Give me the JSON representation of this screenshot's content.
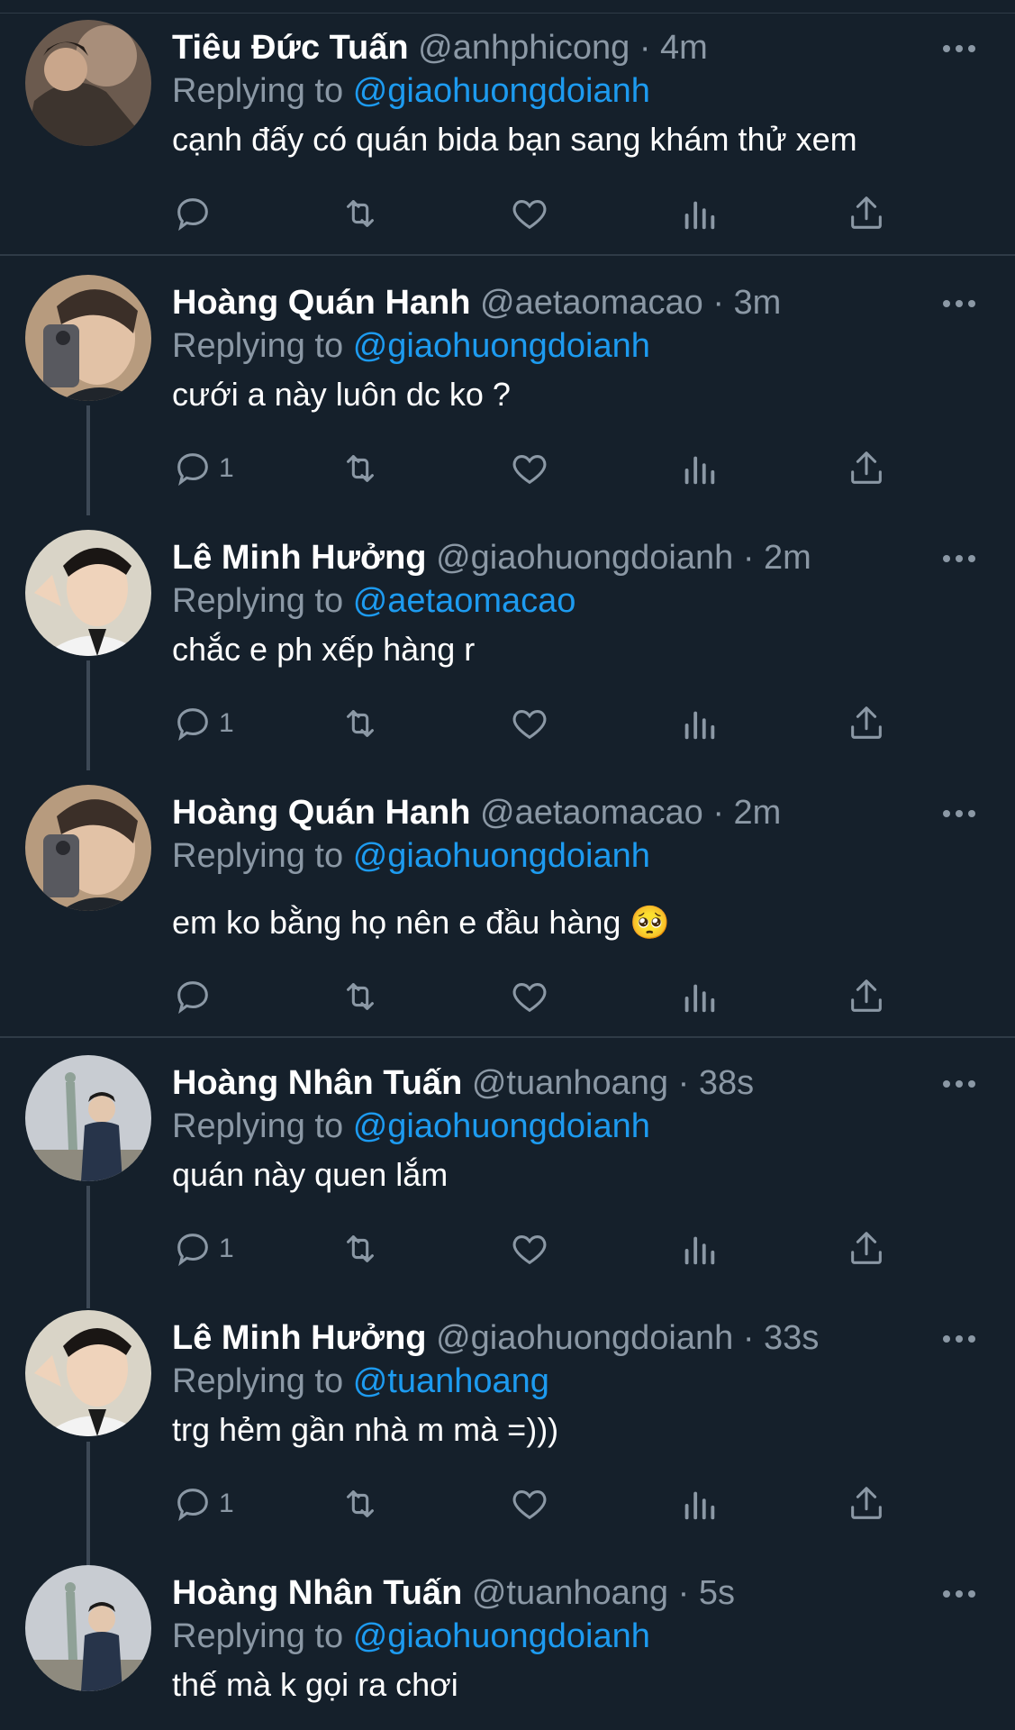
{
  "colors": {
    "background": "#15202b",
    "mention": "#1d9bf0",
    "muted": "#8b98a5",
    "divider": "#2f3b47"
  },
  "icons": {
    "reply": "reply-icon",
    "retweet": "retweet-icon",
    "like": "heart-icon",
    "analytics": "analytics-icon",
    "share": "share-icon",
    "more": "more-icon"
  },
  "tweets": [
    {
      "name": "Tiêu Đức Tuấn",
      "handle": "@anhphicong",
      "dot": "·",
      "time": "4m",
      "replying_label": "Replying to",
      "replying_to": "@giaohuongdoianh",
      "text": "cạnh đấy có quán bida bạn sang khám thử xem",
      "reply_count": ""
    },
    {
      "name": "Hoàng Quán Hanh",
      "handle": "@aetaomacao",
      "dot": "·",
      "time": "3m",
      "replying_label": "Replying to",
      "replying_to": "@giaohuongdoianh",
      "text": "cưới a này luôn dc ko ?",
      "reply_count": "1"
    },
    {
      "name": "Lê Minh Hưởng",
      "handle": "@giaohuongdoianh",
      "dot": "·",
      "time": "2m",
      "replying_label": "Replying to",
      "replying_to": "@aetaomacao",
      "text": "chắc e ph xếp hàng r",
      "reply_count": "1"
    },
    {
      "name": "Hoàng Quán Hanh",
      "handle": "@aetaomacao",
      "dot": "·",
      "time": "2m",
      "replying_label": "Replying to",
      "replying_to": "@giaohuongdoianh",
      "text": "em ko bằng họ nên e đầu hàng 🥺",
      "reply_count": ""
    },
    {
      "name": "Hoàng Nhân Tuấn",
      "handle": "@tuanhoang",
      "dot": "·",
      "time": "38s",
      "replying_label": "Replying to",
      "replying_to": "@giaohuongdoianh",
      "text": "quán này quen lắm",
      "reply_count": "1"
    },
    {
      "name": "Lê Minh Hưởng",
      "handle": "@giaohuongdoianh",
      "dot": "·",
      "time": "33s",
      "replying_label": "Replying to",
      "replying_to": "@tuanhoang",
      "text": "trg hẻm gần nhà m mà =)))",
      "reply_count": "1"
    },
    {
      "name": "Hoàng Nhân Tuấn",
      "handle": "@tuanhoang",
      "dot": "·",
      "time": "5s",
      "replying_label": "Replying to",
      "replying_to": "@giaohuongdoianh",
      "text": "thế mà k gọi ra chơi",
      "reply_count": ""
    }
  ]
}
